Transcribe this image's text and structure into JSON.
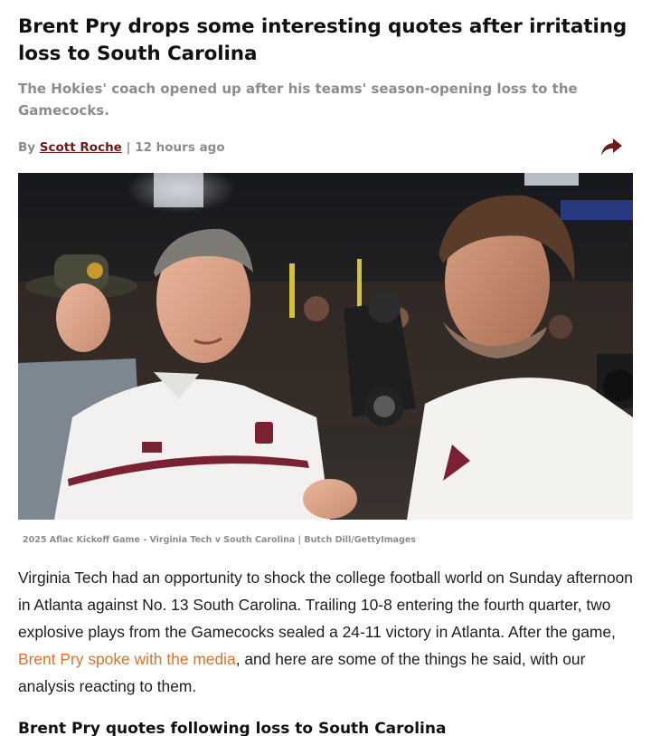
{
  "article": {
    "headline": "Brent Pry drops some interesting quotes after irritating loss to South Carolina",
    "subheadline": "The Hokies' coach opened up after his teams' season-opening loss to the Gamecocks.",
    "byline": {
      "prefix": "By ",
      "author": "Scott Roche",
      "separator": " | ",
      "time": "12 hours ago"
    },
    "share_icon": "share-arrow-icon",
    "image_caption": "2025 Aflac Kickoff Game - Virginia Tech v South Carolina | Butch Dill/GettyImages",
    "body": {
      "text_before_link": "Virginia Tech had an opportunity to shock the college football world on Sunday afternoon in Atlanta against No. 13 South Carolina. Trailing 10-8 entering the fourth quarter, two explosive plays from the Gamecocks sealed a 24-11 victory in Atlanta. After the game, ",
      "link_text": "Brent Pry spoke with the media",
      "text_after_link": ", and here are some of the things he said, with our analysis reacting to them."
    },
    "section_heading": "Brent Pry quotes following loss to South Carolina"
  },
  "colors": {
    "author_link": "#6b1a1a",
    "body_link": "#e46f24",
    "muted": "#8c8c8c",
    "share_icon": "#6b1a1a"
  }
}
